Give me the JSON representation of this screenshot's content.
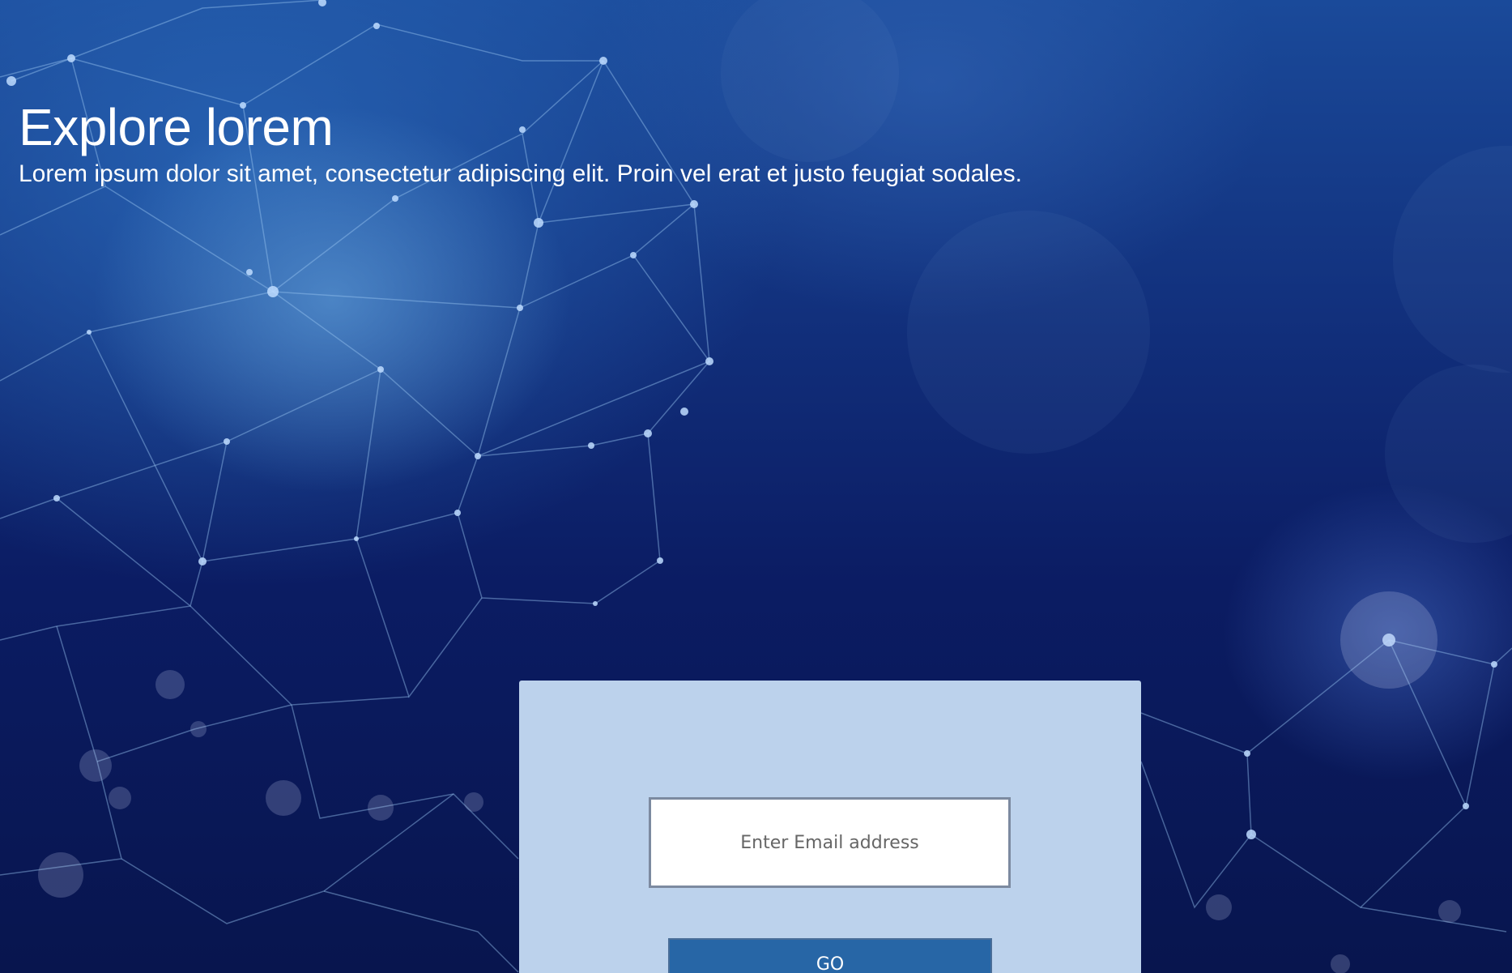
{
  "hero": {
    "title": "Explore lorem",
    "subtitle": "Lorem ipsum dolor sit amet, consectetur adipiscing elit. Proin vel erat et justo feugiat sodales."
  },
  "signup": {
    "email_placeholder": "Enter Email address",
    "email_value": "",
    "button_label": "GO"
  },
  "colors": {
    "background_dark": "#0a1a5c",
    "panel": "#bcd2ec",
    "button": "#2766a6",
    "text": "#ffffff"
  }
}
